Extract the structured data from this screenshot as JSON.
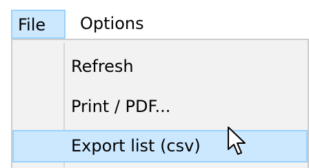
{
  "menubar": {
    "items": [
      {
        "label": "File",
        "active": true
      },
      {
        "label": "Options",
        "active": false
      }
    ]
  },
  "dropdown": {
    "items": [
      {
        "label": "Refresh",
        "highlighted": false
      },
      {
        "label": "Print / PDF...",
        "highlighted": false
      },
      {
        "label": "Export list (csv)",
        "highlighted": true
      }
    ]
  },
  "colors": {
    "highlight_fill": "#cce8ff",
    "highlight_border": "#99d1ff",
    "menu_background": "#f2f2f2"
  },
  "cursor": {
    "icon": "arrow-cursor-icon"
  }
}
